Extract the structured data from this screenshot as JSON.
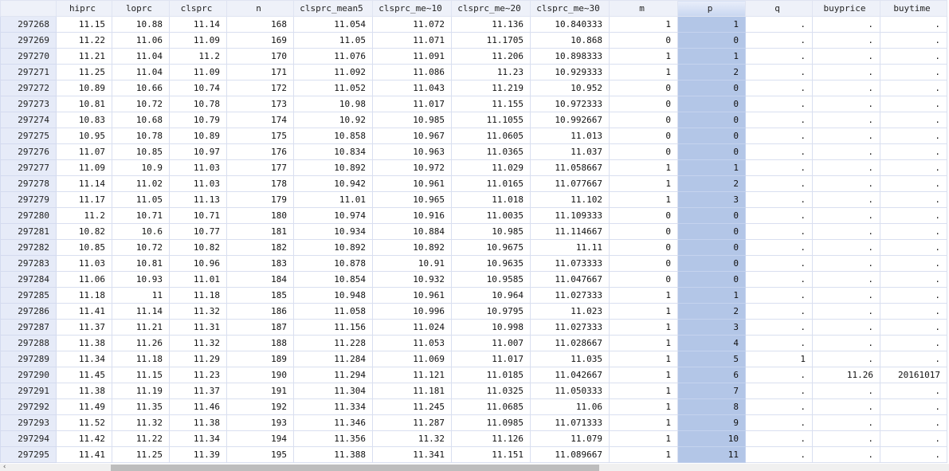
{
  "columns": [
    "",
    "hiprc",
    "loprc",
    "clsprc",
    "n",
    "clsprc_mean5",
    "clsprc_me~10",
    "clsprc_me~20",
    "clsprc_me~30",
    "m",
    "p",
    "q",
    "buyprice",
    "buytime"
  ],
  "selected_column": "p",
  "rows": [
    [
      "297268",
      "11.15",
      "10.88",
      "11.14",
      "168",
      "11.054",
      "11.072",
      "11.136",
      "10.840333",
      "1",
      "1",
      ".",
      ".",
      "."
    ],
    [
      "297269",
      "11.22",
      "11.06",
      "11.09",
      "169",
      "11.05",
      "11.071",
      "11.1705",
      "10.868",
      "0",
      "0",
      ".",
      ".",
      "."
    ],
    [
      "297270",
      "11.21",
      "11.04",
      "11.2",
      "170",
      "11.076",
      "11.091",
      "11.206",
      "10.898333",
      "1",
      "1",
      ".",
      ".",
      "."
    ],
    [
      "297271",
      "11.25",
      "11.04",
      "11.09",
      "171",
      "11.092",
      "11.086",
      "11.23",
      "10.929333",
      "1",
      "2",
      ".",
      ".",
      "."
    ],
    [
      "297272",
      "10.89",
      "10.66",
      "10.74",
      "172",
      "11.052",
      "11.043",
      "11.219",
      "10.952",
      "0",
      "0",
      ".",
      ".",
      "."
    ],
    [
      "297273",
      "10.81",
      "10.72",
      "10.78",
      "173",
      "10.98",
      "11.017",
      "11.155",
      "10.972333",
      "0",
      "0",
      ".",
      ".",
      "."
    ],
    [
      "297274",
      "10.83",
      "10.68",
      "10.79",
      "174",
      "10.92",
      "10.985",
      "11.1055",
      "10.992667",
      "0",
      "0",
      ".",
      ".",
      "."
    ],
    [
      "297275",
      "10.95",
      "10.78",
      "10.89",
      "175",
      "10.858",
      "10.967",
      "11.0605",
      "11.013",
      "0",
      "0",
      ".",
      ".",
      "."
    ],
    [
      "297276",
      "11.07",
      "10.85",
      "10.97",
      "176",
      "10.834",
      "10.963",
      "11.0365",
      "11.037",
      "0",
      "0",
      ".",
      ".",
      "."
    ],
    [
      "297277",
      "11.09",
      "10.9",
      "11.03",
      "177",
      "10.892",
      "10.972",
      "11.029",
      "11.058667",
      "1",
      "1",
      ".",
      ".",
      "."
    ],
    [
      "297278",
      "11.14",
      "11.02",
      "11.03",
      "178",
      "10.942",
      "10.961",
      "11.0165",
      "11.077667",
      "1",
      "2",
      ".",
      ".",
      "."
    ],
    [
      "297279",
      "11.17",
      "11.05",
      "11.13",
      "179",
      "11.01",
      "10.965",
      "11.018",
      "11.102",
      "1",
      "3",
      ".",
      ".",
      "."
    ],
    [
      "297280",
      "11.2",
      "10.71",
      "10.71",
      "180",
      "10.974",
      "10.916",
      "11.0035",
      "11.109333",
      "0",
      "0",
      ".",
      ".",
      "."
    ],
    [
      "297281",
      "10.82",
      "10.6",
      "10.77",
      "181",
      "10.934",
      "10.884",
      "10.985",
      "11.114667",
      "0",
      "0",
      ".",
      ".",
      "."
    ],
    [
      "297282",
      "10.85",
      "10.72",
      "10.82",
      "182",
      "10.892",
      "10.892",
      "10.9675",
      "11.11",
      "0",
      "0",
      ".",
      ".",
      "."
    ],
    [
      "297283",
      "11.03",
      "10.81",
      "10.96",
      "183",
      "10.878",
      "10.91",
      "10.9635",
      "11.073333",
      "0",
      "0",
      ".",
      ".",
      "."
    ],
    [
      "297284",
      "11.06",
      "10.93",
      "11.01",
      "184",
      "10.854",
      "10.932",
      "10.9585",
      "11.047667",
      "0",
      "0",
      ".",
      ".",
      "."
    ],
    [
      "297285",
      "11.18",
      "11",
      "11.18",
      "185",
      "10.948",
      "10.961",
      "10.964",
      "11.027333",
      "1",
      "1",
      ".",
      ".",
      "."
    ],
    [
      "297286",
      "11.41",
      "11.14",
      "11.32",
      "186",
      "11.058",
      "10.996",
      "10.9795",
      "11.023",
      "1",
      "2",
      ".",
      ".",
      "."
    ],
    [
      "297287",
      "11.37",
      "11.21",
      "11.31",
      "187",
      "11.156",
      "11.024",
      "10.998",
      "11.027333",
      "1",
      "3",
      ".",
      ".",
      "."
    ],
    [
      "297288",
      "11.38",
      "11.26",
      "11.32",
      "188",
      "11.228",
      "11.053",
      "11.007",
      "11.028667",
      "1",
      "4",
      ".",
      ".",
      "."
    ],
    [
      "297289",
      "11.34",
      "11.18",
      "11.29",
      "189",
      "11.284",
      "11.069",
      "11.017",
      "11.035",
      "1",
      "5",
      "1",
      ".",
      "."
    ],
    [
      "297290",
      "11.45",
      "11.15",
      "11.23",
      "190",
      "11.294",
      "11.121",
      "11.0185",
      "11.042667",
      "1",
      "6",
      ".",
      "11.26",
      "20161017"
    ],
    [
      "297291",
      "11.38",
      "11.19",
      "11.37",
      "191",
      "11.304",
      "11.181",
      "11.0325",
      "11.050333",
      "1",
      "7",
      ".",
      ".",
      "."
    ],
    [
      "297292",
      "11.49",
      "11.35",
      "11.46",
      "192",
      "11.334",
      "11.245",
      "11.0685",
      "11.06",
      "1",
      "8",
      ".",
      ".",
      "."
    ],
    [
      "297293",
      "11.52",
      "11.32",
      "11.38",
      "193",
      "11.346",
      "11.287",
      "11.0985",
      "11.071333",
      "1",
      "9",
      ".",
      ".",
      "."
    ],
    [
      "297294",
      "11.42",
      "11.22",
      "11.34",
      "194",
      "11.356",
      "11.32",
      "11.126",
      "11.079",
      "1",
      "10",
      ".",
      ".",
      "."
    ],
    [
      "297295",
      "11.41",
      "11.25",
      "11.39",
      "195",
      "11.388",
      "11.341",
      "11.151",
      "11.089667",
      "1",
      "11",
      ".",
      ".",
      "."
    ]
  ],
  "colors": {
    "selected_column": "#b3c6e7",
    "row_header": "#e6ebf8",
    "grid_line": "#d9dff0"
  }
}
